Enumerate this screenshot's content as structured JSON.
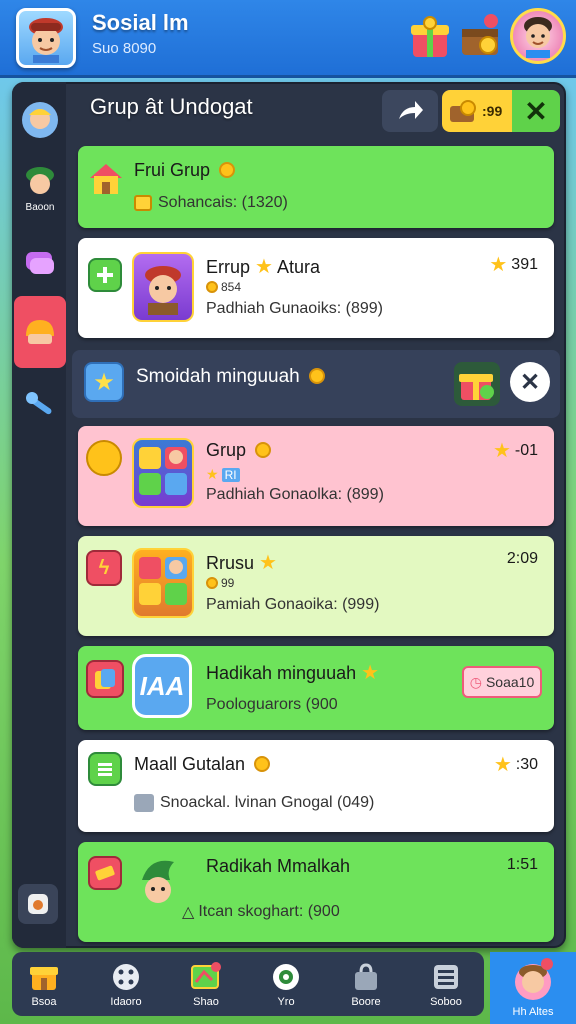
{
  "top_bar": {
    "title": "Sosial lm",
    "subtitle": "Suo 8090",
    "icons": [
      "gift-box-icon",
      "treasure-chest-icon",
      "profile-avatar-icon"
    ]
  },
  "panel": {
    "title": "Grup ât Undogat",
    "coin_value": ":99"
  },
  "left_rail": [
    {
      "icon": "avatar-icon",
      "label": ""
    },
    {
      "icon": "soldier-icon",
      "label": "Baoon"
    },
    {
      "icon": "chat-icon",
      "label": ""
    },
    {
      "icon": "helmet-icon",
      "label": ""
    },
    {
      "icon": "tools-icon",
      "label": ""
    }
  ],
  "cards_top": [
    {
      "title": "Frui Grup",
      "sub": "Sohancais: (1320)",
      "color": "#6ee35b"
    },
    {
      "title": "Errup",
      "title2": "Atura",
      "right": "391",
      "small": "854",
      "sub": "Padhiah Gunaoiks: (899)",
      "color": "#ffffff"
    }
  ],
  "sub_header": {
    "title": "Smoidah minguuah"
  },
  "cards": [
    {
      "title": "Grup",
      "right": "-01",
      "small": "RI",
      "sub": "Padhiah Gonaolka: (899)",
      "color": "#ffc3d0"
    },
    {
      "title": "Rrusu",
      "right": "2:09",
      "small": "99",
      "sub": "Pamiah Gonaoika: (999)",
      "color": "#e3f9c1"
    },
    {
      "title": "Hadikah minguuah",
      "sub": "Poologuarors (900",
      "button": "Soaa10",
      "color": "#6ee35b"
    },
    {
      "title": "Maall Gutalan",
      "right": ":30",
      "sub": "Snoackal. lvinan Gnogal (049)",
      "color": "#ffffff"
    },
    {
      "title": "Radikah Mmalkah",
      "right": "1:51",
      "sub": "Itcan skoghart: (900",
      "color": "#6ee35b"
    }
  ],
  "bottom_nav": [
    {
      "icon": "shop-icon",
      "label": "Bsoa"
    },
    {
      "icon": "dice-icon",
      "label": "Idaoro"
    },
    {
      "icon": "map-icon",
      "label": "Shao"
    },
    {
      "icon": "compass-icon",
      "label": "Yro"
    },
    {
      "icon": "bag-icon",
      "label": "Boore"
    },
    {
      "icon": "grid-icon",
      "label": "Soboo"
    }
  ],
  "nav_profile": {
    "label": "Hh Altes"
  }
}
